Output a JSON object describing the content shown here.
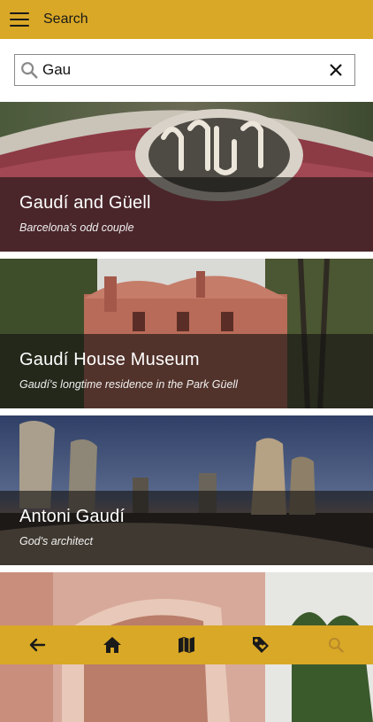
{
  "header": {
    "title": "Search",
    "menu_icon": "menu-icon"
  },
  "search": {
    "value": "Gau",
    "placeholder": "",
    "search_icon": "search-icon",
    "clear_icon": "close-icon"
  },
  "results": [
    {
      "title": "Gaudí and Güell",
      "subtitle": "Barcelona's odd couple"
    },
    {
      "title": "Gaudí House Museum",
      "subtitle": "Gaudí's longtime residence in the Park Güell"
    },
    {
      "title": "Antoni Gaudí",
      "subtitle": "God's architect"
    },
    {
      "title": "",
      "subtitle": ""
    }
  ],
  "bottom_nav": [
    {
      "name": "back",
      "icon": "arrow-left-icon"
    },
    {
      "name": "home",
      "icon": "home-icon"
    },
    {
      "name": "map",
      "icon": "map-icon"
    },
    {
      "name": "tags",
      "icon": "tag-icon"
    },
    {
      "name": "search",
      "icon": "search-icon",
      "state": "active"
    }
  ],
  "colors": {
    "accent": "#d9a826",
    "dark": "#1a1a1a",
    "muted": "#b8892a"
  }
}
